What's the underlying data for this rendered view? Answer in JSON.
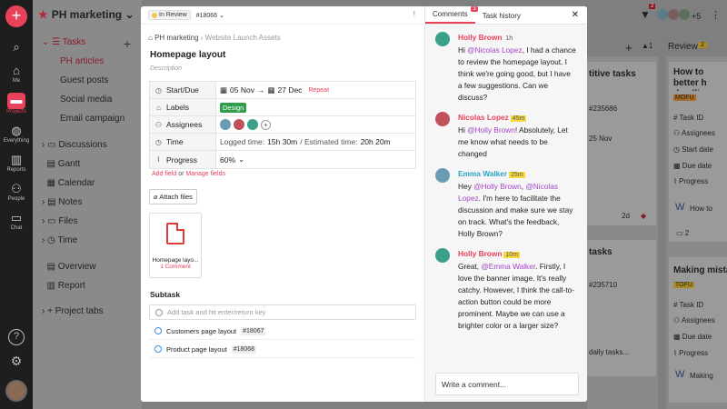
{
  "rail": {
    "items": [
      {
        "label": "Me"
      },
      {
        "label": "Projects"
      },
      {
        "label": "Everything"
      },
      {
        "label": "Reports"
      },
      {
        "label": "People"
      },
      {
        "label": "Chat"
      }
    ]
  },
  "sidebar": {
    "project": "PH marketing",
    "items": [
      "Tasks",
      "PH articles",
      "Guest posts",
      "Social media",
      "Email campaign",
      "Discussions",
      "Gantt",
      "Calendar",
      "Notes",
      "Files",
      "Time",
      "Overview",
      "Report",
      "Project tabs"
    ]
  },
  "board": {
    "review_label": "Review",
    "review_count": "2",
    "plus_more": "+5",
    "notif_count": "2",
    "col1": {
      "card1_title": "titive tasks",
      "card1_id": "#235686",
      "card1_date": "25 Nov",
      "card1_due": "2d",
      "card2_title": "tasks",
      "card2_id": "#235710",
      "card2_text": "daily tasks..."
    },
    "col2": {
      "card1_title": "How to better h deadlines as a",
      "card1_tag": "MOFU",
      "card1_fields": [
        "Task ID",
        "Assignees",
        "Start date",
        "Due date",
        "Progress"
      ],
      "card1_doc": "How to",
      "card1_comments": "2",
      "card2_title": "Making mistak",
      "card2_tag": "TOFU",
      "card2_fields": [
        "Task ID",
        "Assignees",
        "Due date",
        "Progress"
      ],
      "card2_doc": "Making"
    }
  },
  "modal": {
    "status": "In Review",
    "task_id": "#18066",
    "breadcrumb_project": "PH marketing",
    "breadcrumb_list": "Website Launch Assets",
    "title": "Homepage layout",
    "description_placeholder": "Description",
    "props": {
      "start_due_label": "Start/Due",
      "start": "05 Nov",
      "due": "27 Dec",
      "repeat": "Repeat",
      "labels_label": "Labels",
      "label_value": "Design",
      "assignees_label": "Assignees",
      "time_label": "Time",
      "logged_prefix": "Logged time:",
      "logged": "15h 30m",
      "estimated_prefix": "/ Estimated time:",
      "estimated": "20h 20m",
      "progress_label": "Progress",
      "progress": "60%"
    },
    "add_field": "Add field",
    "or": "or",
    "manage_fields": "Manage fields",
    "attach_files": "Attach files",
    "file": {
      "name": "Homepage layo...",
      "comments": "1 Comment"
    },
    "subtask_heading": "Subtask",
    "subtask_placeholder": "Add task and hit enter/return key",
    "subtasks": [
      {
        "name": "Customers page layout",
        "id": "#18067"
      },
      {
        "name": "Product page layout",
        "id": "#18068"
      }
    ]
  },
  "panel": {
    "tab_comments": "Comments",
    "comments_count": "3",
    "tab_history": "Task history",
    "comments": [
      {
        "author": "Holly Brown",
        "time": "1h",
        "color": "#e8415a",
        "p1": "Hi ",
        "mention1": "@Nicolas Lopez",
        "p2": ", I had a chance to review the homepage layout. I think we're going good, but I have a few suggestions. Can we discuss?",
        "mention2": "",
        "p3": ""
      },
      {
        "author": "Nicolas Lopez",
        "time": "45m",
        "color": "#e8415a",
        "p1": "Hi ",
        "mention1": "@Holly Brown",
        "p2": "! Absolutely, Let me know what needs to be changed",
        "mention2": "",
        "p3": ""
      },
      {
        "author": "Emma Walker",
        "time": "25m",
        "color": "#2aa5c7",
        "p1": "Hey ",
        "mention1": "@Holly Brown",
        "p2": ", ",
        "mention2": "@Nicolas Lopez",
        "p3": ". I'm here to facilitate the discussion and make sure we stay on track. What's the feedback, Holly Brown?"
      },
      {
        "author": "Holly Brown",
        "time": "10m",
        "color": "#e8415a",
        "p1": "Great, ",
        "mention1": "@Emma Walker",
        "p2": ". Firstly, I love the banner image. It's really catchy. However, I think the call-to-action button could be more prominent. Maybe we can use a brighter color or a larger size?",
        "mention2": "",
        "p3": ""
      }
    ],
    "comment_placeholder": "Write a comment..."
  }
}
